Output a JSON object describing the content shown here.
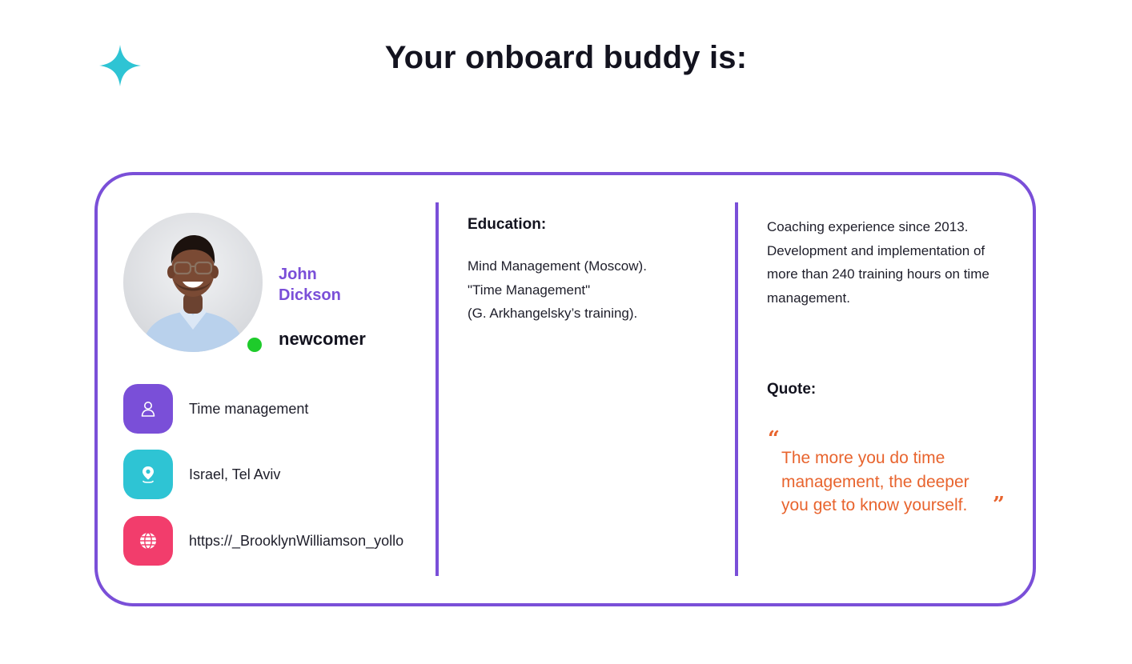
{
  "header": {
    "title": "Your onboard buddy is:",
    "accent_color": "#2ec4d4"
  },
  "profile": {
    "first_name": "John",
    "last_name": "Dickson",
    "role": "newcomer",
    "status_color": "#1ecb2b",
    "name_color": "#7a4fd8"
  },
  "info": [
    {
      "icon": "user-icon",
      "color": "#7a4fd8",
      "text": "Time management"
    },
    {
      "icon": "location-pin-icon",
      "color": "#2ec4d4",
      "text": "Israel, Tel Aviv"
    },
    {
      "icon": "globe-icon",
      "color": "#f23d6c",
      "text": "https://_BrooklynWilliamson_yollo"
    }
  ],
  "education": {
    "title": "Education:",
    "lines": [
      "Mind Management (Moscow).",
      "\"Time Management\"",
      "(G. Arkhangelsky’s training)."
    ]
  },
  "experience": {
    "text": "Coaching experience since 2013. Development and implementation of more than 240 training hours on time management."
  },
  "quote": {
    "title": "Quote:",
    "open_mark": "“",
    "text": "The more you do time management, the deeper you get to know yourself.",
    "close_mark": "”",
    "color": "#e8642e"
  }
}
